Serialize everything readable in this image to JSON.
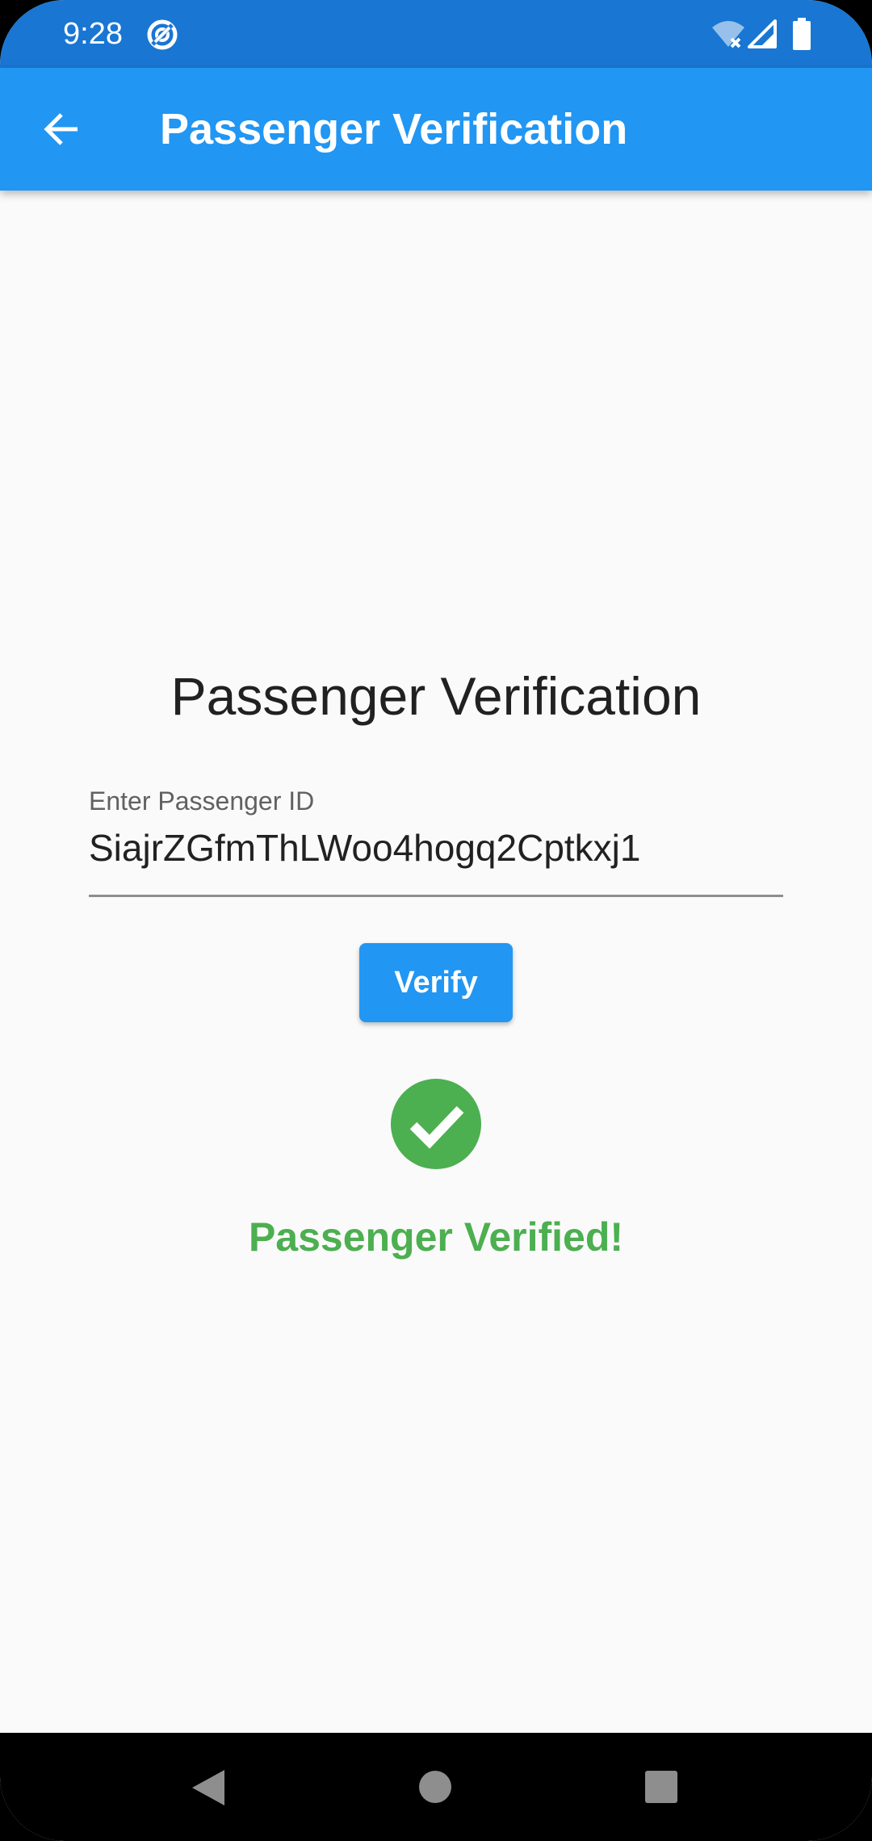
{
  "status_bar": {
    "time": "9:28",
    "icons": [
      "sync-icon",
      "wifi-off-icon",
      "signal-icon",
      "battery-icon"
    ]
  },
  "app_bar": {
    "title": "Passenger Verification",
    "back_icon": "arrow-back-icon"
  },
  "content": {
    "heading": "Passenger Verification",
    "id_field": {
      "label": "Enter Passenger ID",
      "value": "SiajrZGfmThLWoo4hogq2Cptkxj1"
    },
    "verify_button_label": "Verify",
    "result": {
      "icon": "check-circle-icon",
      "message": "Passenger Verified!"
    }
  },
  "nav_bar": {
    "icons": [
      "nav-back-icon",
      "nav-home-icon",
      "nav-recents-icon"
    ]
  },
  "colors": {
    "status_bar": "#1976D2",
    "app_bar": "#2196F3",
    "background": "#FAFAFA",
    "success": "#4CAF50",
    "button": "#2196F3"
  }
}
